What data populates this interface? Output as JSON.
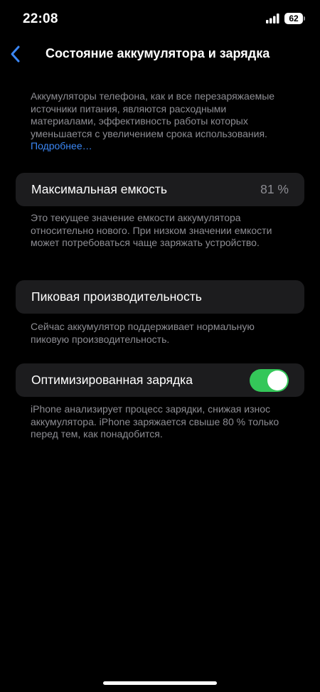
{
  "status_bar": {
    "time": "22:08",
    "battery_level": "62"
  },
  "nav": {
    "title": "Состояние аккумулятора и зарядка"
  },
  "intro": {
    "text": "Аккумуляторы телефона, как и все перезаряжаемые источники питания, являются расходными материалами, эффективность работы которых уменьшается с увеличением срока использования. ",
    "link": "Подробнее…"
  },
  "max_capacity": {
    "label": "Максимальная емкость",
    "value": "81 %",
    "description": "Это текущее значение емкости аккумулятора относительно нового. При низком значении емкости может потребоваться чаще заряжать устройство."
  },
  "peak_performance": {
    "label": "Пиковая производительность",
    "description": "Сейчас аккумулятор поддерживает нормальную пиковую производительность."
  },
  "optimized_charging": {
    "label": "Оптимизированная зарядка",
    "enabled": true,
    "description": "iPhone анализирует процесс зарядки, снижая износ аккумулятора. iPhone заряжается свыше 80 % только перед тем, как понадобится."
  },
  "colors": {
    "background": "#000000",
    "card": "#1c1c1e",
    "secondary_text": "#8d8d93",
    "accent": "#3b87f5",
    "toggle_on": "#34c759"
  }
}
